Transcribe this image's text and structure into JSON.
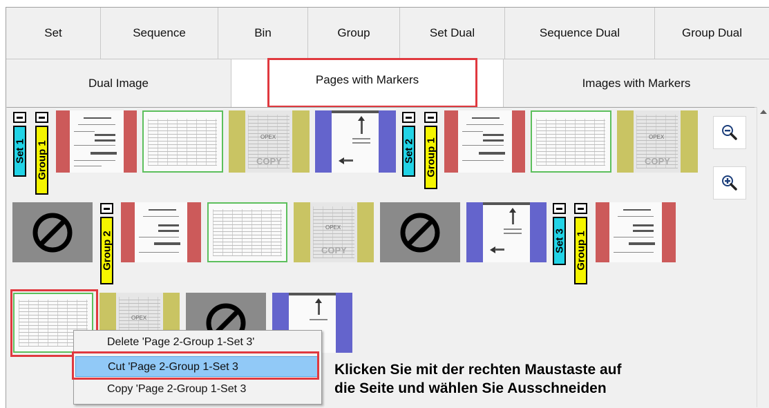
{
  "tabs": {
    "row1": [
      {
        "label": "Set"
      },
      {
        "label": "Sequence"
      },
      {
        "label": "Bin"
      },
      {
        "label": "Group"
      },
      {
        "label": "Set Dual"
      },
      {
        "label": "Sequence Dual"
      },
      {
        "label": "Group Dual"
      }
    ],
    "row2": [
      {
        "label": "Dual Image"
      },
      {
        "label": "Pages with Markers",
        "active": true
      },
      {
        "label": "Images with Markers"
      }
    ]
  },
  "markers": {
    "set1": "Set 1",
    "group1a": "Group 1",
    "set2": "Set 2",
    "group1b": "Group 1",
    "group2": "Group 2",
    "set3": "Set 3",
    "group1c": "Group 1"
  },
  "thumb_text": {
    "stamp": "OPEX",
    "copy": "COPY"
  },
  "zoom": {
    "zoom_out_icon": "zoom-out-icon",
    "zoom_in_icon": "zoom-in-icon"
  },
  "context_menu": {
    "items": [
      {
        "label": "Delete 'Page 2-Group 1-Set 3'"
      },
      {
        "label": "Cut 'Page 2-Group 1-Set 3",
        "selected": true
      },
      {
        "label": "Copy 'Page 2-Group 1-Set 3"
      }
    ]
  },
  "instruction": {
    "line1": "Klicken Sie mit der rechten Maustaste auf",
    "line2": "die Seite und wählen Sie Ausschneiden"
  },
  "colors": {
    "highlight": "#e0393f",
    "set_marker": "#22d3e6",
    "group_marker": "#f5f500",
    "red_page": "#cc5a5a",
    "olive_page": "#c9c463",
    "blue_page": "#6464cc",
    "gray_page": "#8a8a8a",
    "green_page": "#5cbf5c",
    "selection": "#91c9f7"
  }
}
